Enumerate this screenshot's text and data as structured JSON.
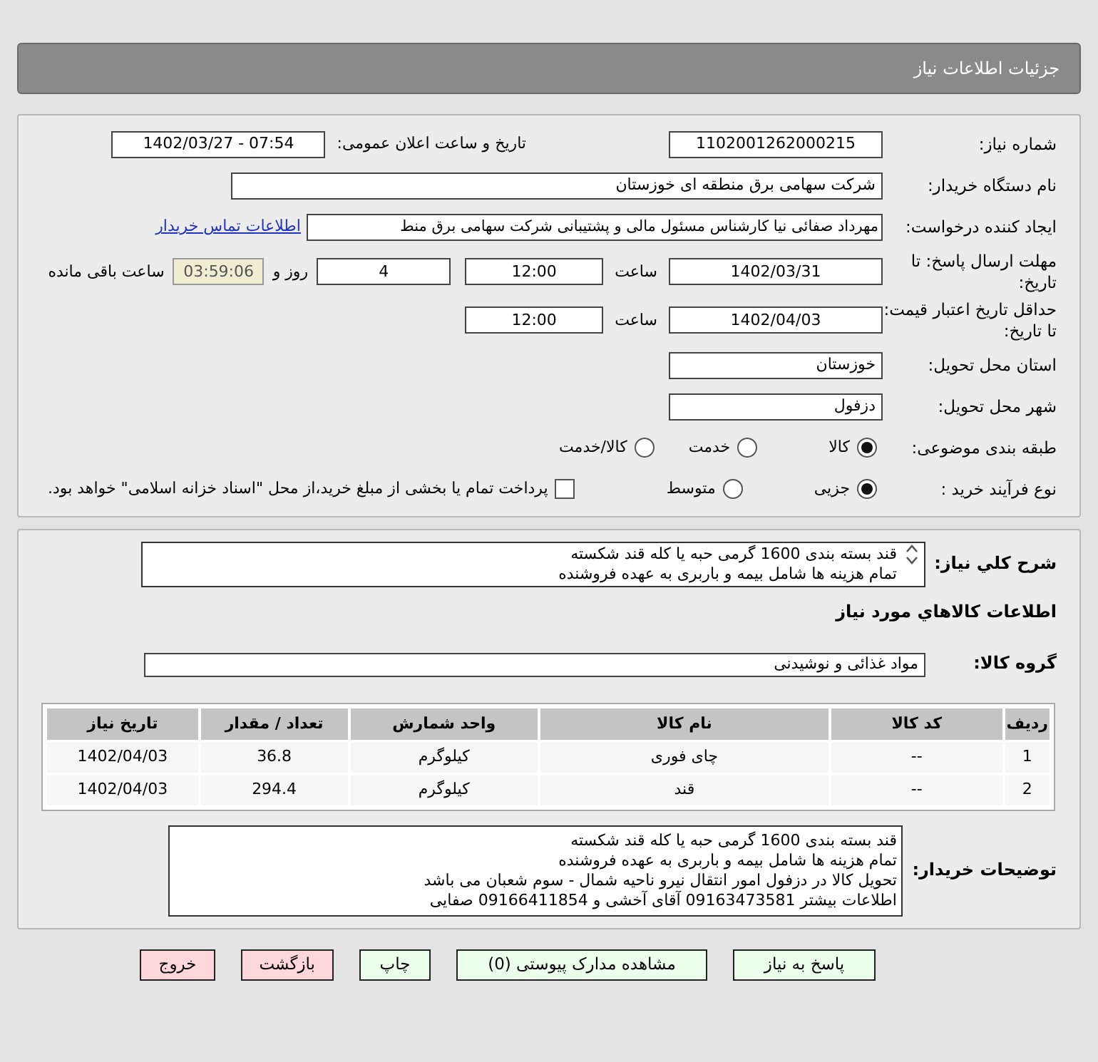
{
  "header": {
    "title": "جزئیات اطلاعات نیاز"
  },
  "need_number": {
    "label": "شماره نیاز:",
    "value": "1102001262000215"
  },
  "announce": {
    "label": "تاریخ و ساعت اعلان عمومی:",
    "value": "1402/03/27 - 07:54"
  },
  "buyer_org": {
    "label": "نام دستگاه خریدار:",
    "value": "شرکت سهامی برق منطقه ای خوزستان"
  },
  "requester": {
    "label": "ایجاد کننده درخواست:",
    "value": "مهرداد صفائی نیا کارشناس مسئول مالی و پشتیبانی شرکت سهامی برق منط",
    "link": "اطلاعات تماس خریدار"
  },
  "deadline": {
    "label": "مهلت ارسال پاسخ: تا تاریخ:",
    "date": "1402/03/31",
    "time_label": "ساعت",
    "time": "12:00",
    "days": "4",
    "days_label": "روز و",
    "remaining": "03:59:06",
    "remaining_label": "ساعت باقی مانده"
  },
  "validity": {
    "label": "حداقل تاریخ اعتبار قیمت: تا تاریخ:",
    "date": "1402/04/03",
    "time_label": "ساعت",
    "time": "12:00"
  },
  "province": {
    "label": "استان محل تحویل:",
    "value": "خوزستان"
  },
  "city": {
    "label": "شهر محل تحویل:",
    "value": "دزفول"
  },
  "category": {
    "label": "طبقه بندی موضوعی:",
    "options": [
      {
        "label": "کالا",
        "selected": true
      },
      {
        "label": "خدمت",
        "selected": false
      },
      {
        "label": "کالا/خدمت",
        "selected": false
      }
    ]
  },
  "purchase_type": {
    "label": "نوع فرآیند خرید :",
    "options": [
      {
        "label": "جزیی",
        "selected": true
      },
      {
        "label": "متوسط",
        "selected": false
      }
    ],
    "payment": {
      "checked": false,
      "label": "پرداخت تمام یا بخشی از مبلغ خرید،از محل \"اسناد خزانه اسلامی\" خواهد بود."
    }
  },
  "summary": {
    "label": "شرح کلي نياز:",
    "lines": [
      "قند بسته بندی 1600 گرمی حبه یا کله قند شکسته",
      "تمام  هزینه ها شامل بیمه و باربری به عهده فروشنده"
    ]
  },
  "goods_heading": "اطلاعات كالاهاي مورد نياز",
  "goods_group": {
    "label": "گروه کالا:",
    "value": "مواد غذائی و نوشیدنی"
  },
  "table": {
    "columns": [
      "ردیف",
      "کد کالا",
      "نام کالا",
      "واحد شمارش",
      "تعداد / مقدار",
      "تاریخ نیاز"
    ],
    "rows": [
      [
        "1",
        "--",
        "چای فوری",
        "کیلوگرم",
        "36.8",
        "1402/04/03"
      ],
      [
        "2",
        "--",
        "قند",
        "کیلوگرم",
        "294.4",
        "1402/04/03"
      ]
    ]
  },
  "buyer_notes": {
    "label": "توضیحات خریدار:",
    "lines": [
      "قند بسته بندی 1600 گرمی حبه یا کله قند شکسته",
      "تمام  هزینه ها شامل بیمه و باربری به عهده فروشنده",
      "تحویل کالا  در دزفول امور انتقال نیرو ناحیه شمال - سوم شعبان  می باشد",
      "اطلاعات بیشتر   09163473581 آقای آخشی   و    09166411854  صفایی"
    ]
  },
  "buttons": [
    {
      "label": "پاسخ به نیاز",
      "kind": "action"
    },
    {
      "label": "مشاهده مدارک پیوستی (0)",
      "kind": "action"
    },
    {
      "label": "چاپ",
      "kind": "action"
    },
    {
      "label": "بازگشت",
      "kind": "exit"
    },
    {
      "label": "خروج",
      "kind": "exit"
    }
  ]
}
